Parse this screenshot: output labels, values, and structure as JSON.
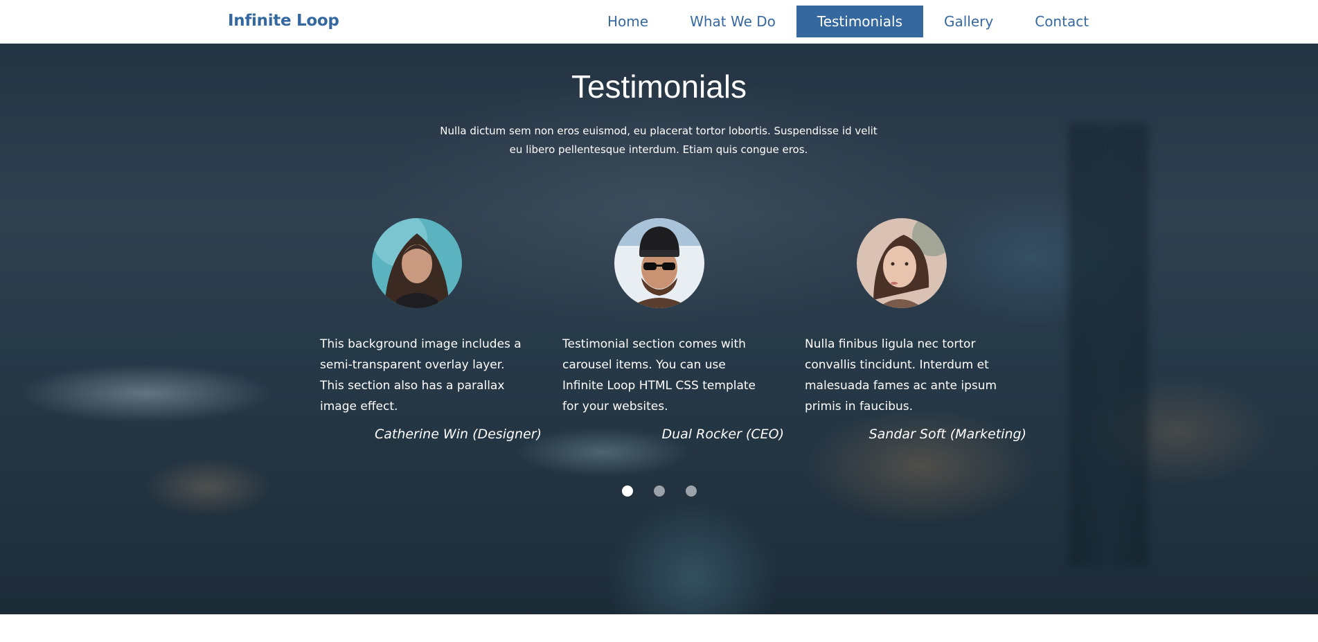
{
  "brand": "Infinite Loop",
  "nav": [
    {
      "label": "Home"
    },
    {
      "label": "What We Do"
    },
    {
      "label": "Testimonials",
      "active": true
    },
    {
      "label": "Gallery"
    },
    {
      "label": "Contact"
    }
  ],
  "section": {
    "title": "Testimonials",
    "intro": "Nulla dictum sem non eros euismod, eu placerat tortor lobortis. Suspendisse id velit eu libero pellentesque interdum. Etiam quis congue eros."
  },
  "testimonials": [
    {
      "quote": "This background image includes a semi-transparent overlay layer. This section also has a parallax image effect.",
      "author": "Catherine Win (Designer)"
    },
    {
      "quote": "Testimonial section comes with carousel items. You can use Infinite Loop HTML CSS template for your websites.",
      "author": "Dual Rocker (CEO)"
    },
    {
      "quote": "Nulla finibus ligula nec tortor convallis tincidunt. Interdum et malesuada fames ac ante ipsum primis in faucibus.",
      "author": "Sandar Soft (Marketing)"
    }
  ],
  "carousel": {
    "page_count": 3,
    "active_page": 1
  },
  "colors": {
    "brand": "#3668a0",
    "nav_active_bg": "#3668a0",
    "text_on_hero": "#ffffff"
  }
}
